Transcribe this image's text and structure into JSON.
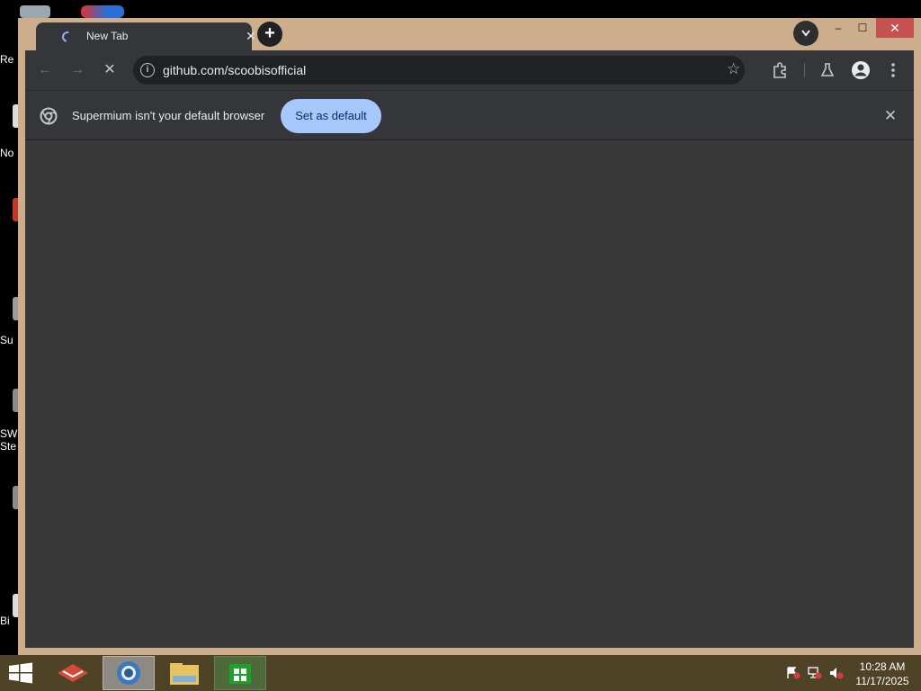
{
  "desktop": {
    "label_fragments": [
      "Re",
      "No",
      "Su",
      "SW",
      "Ste",
      "Bi"
    ]
  },
  "browser": {
    "tab": {
      "title": "New Tab",
      "state": "loading"
    },
    "window_controls": {
      "minimize": "–",
      "maximize": "☐",
      "close": "✕"
    },
    "address_bar": {
      "url": "github.com/scoobisofficial"
    },
    "infobar": {
      "message": "Supermium isn't your default browser",
      "button_label": "Set as default"
    },
    "icons": [
      "back-icon",
      "forward-icon",
      "stop-icon",
      "site-info-icon",
      "bookmark-star-icon",
      "extensions-icon",
      "labs-flask-icon",
      "profile-icon",
      "menu-icon"
    ]
  },
  "taskbar": {
    "items": [
      "start",
      "app-launcher",
      "supermium",
      "file-explorer",
      "store"
    ],
    "active_item": "supermium",
    "clock": {
      "time": "10:28 AM",
      "date": "11/17/2025"
    },
    "tray": [
      "action-center-flag-icon",
      "network-icon",
      "volume-muted-icon"
    ]
  }
}
